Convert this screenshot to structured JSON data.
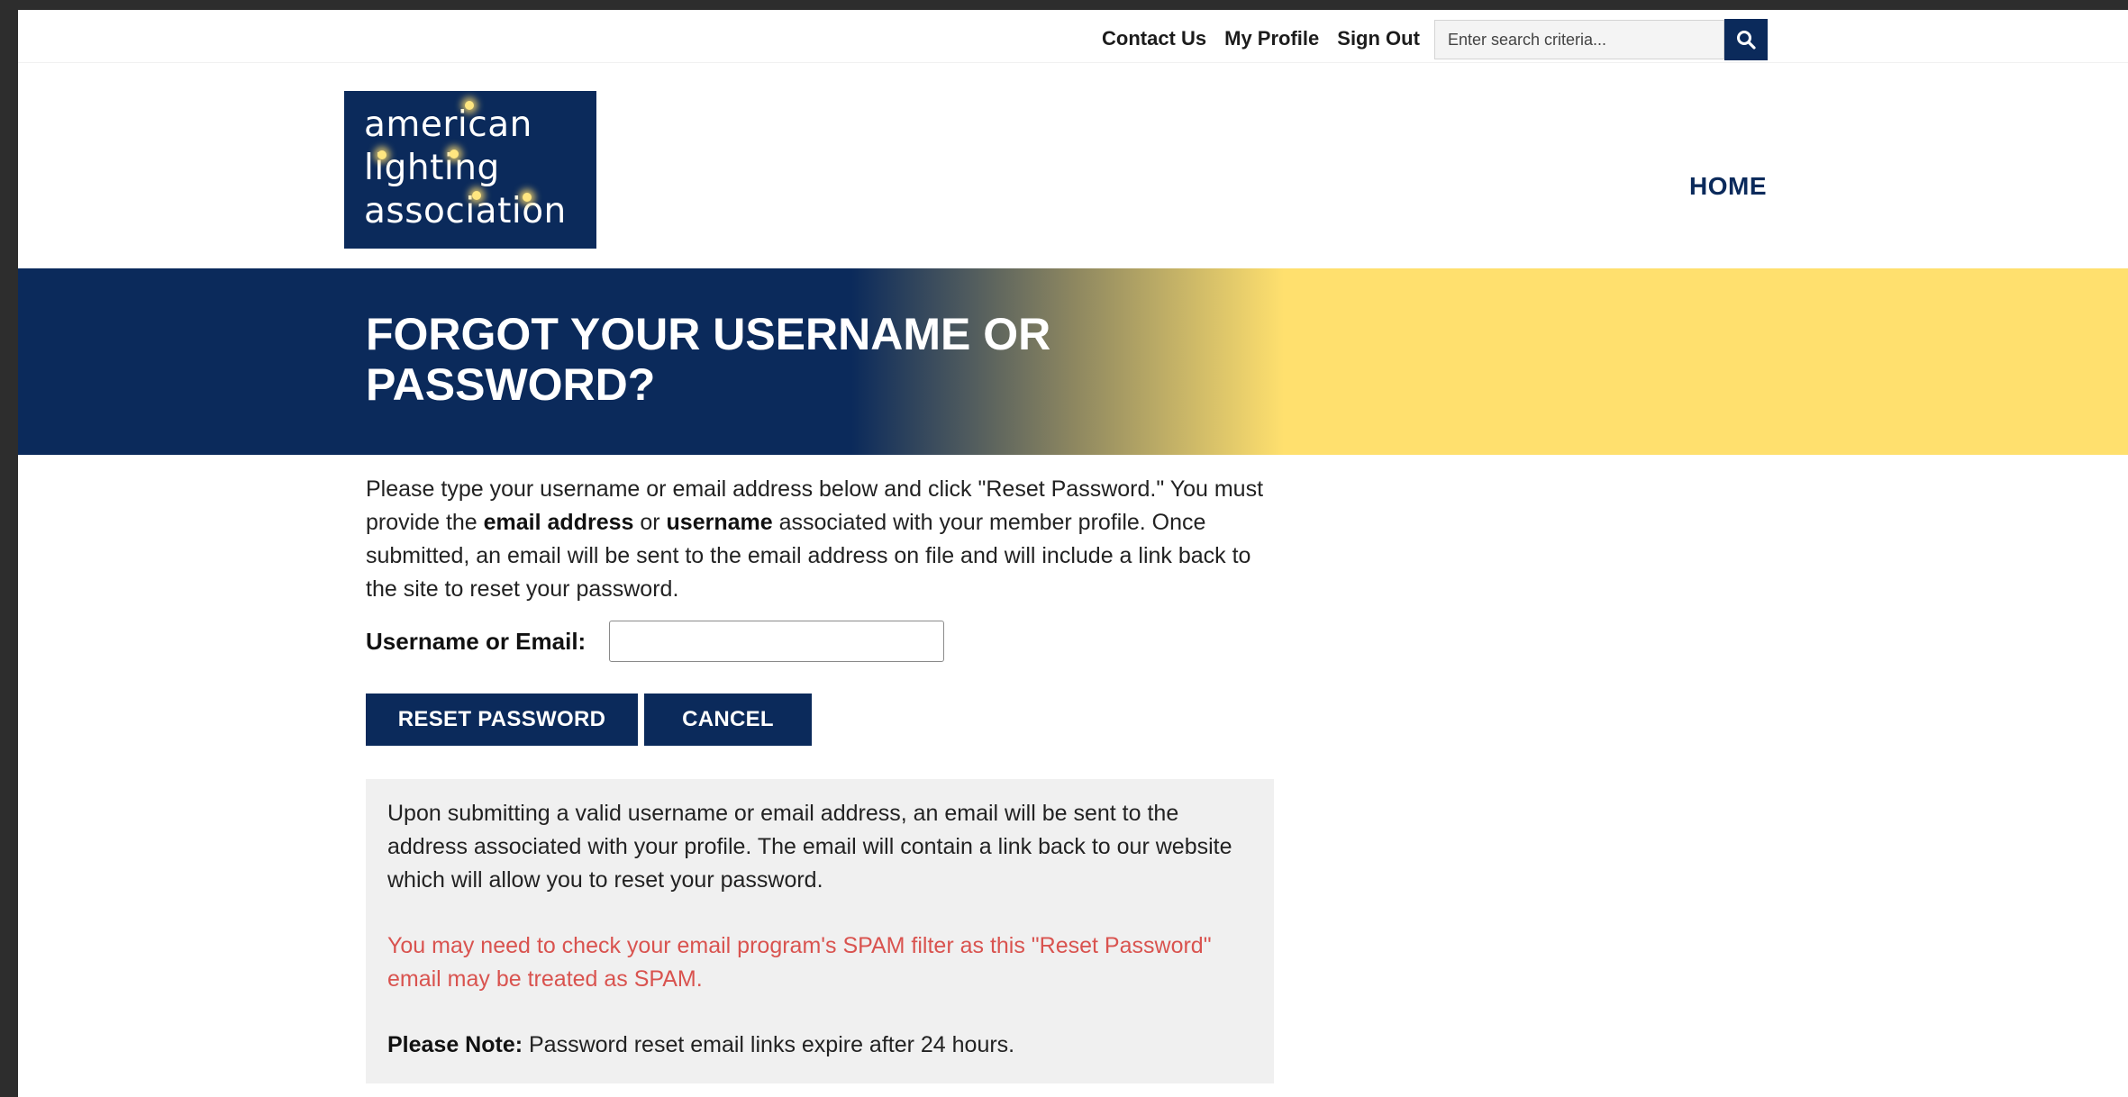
{
  "utility_nav": {
    "contact": "Contact Us",
    "profile": "My Profile",
    "sign_out": "Sign Out"
  },
  "search": {
    "placeholder": "Enter search criteria...",
    "icon": "search-icon"
  },
  "logo": {
    "line1": "american",
    "line2": "lighting",
    "line3": "association"
  },
  "main_nav": {
    "home": "HOME"
  },
  "banner": {
    "title": "FORGOT YOUR USERNAME OR PASSWORD?"
  },
  "intro": {
    "part1": "Please type your username or email address below and click \"Reset Password.\" You must provide the ",
    "bold1": "email address",
    "part2": " or ",
    "bold2": "username",
    "part3": " associated with your member profile. Once submitted, an email will be sent to the email address on file and will include a link back to the site to reset your password."
  },
  "form": {
    "label": "Username or Email:",
    "value": "",
    "reset_label": "RESET PASSWORD",
    "cancel_label": "CANCEL"
  },
  "notice": {
    "text1": "Upon submitting a valid username or email address, an email will be sent to the address associated with your profile. The email will contain a link back to our website which will allow you to reset your password.",
    "warning": "You may need to check your email program's SPAM filter as this \"Reset Password\" email may be treated as SPAM.",
    "note_label": "Please Note:",
    "note_text": " Password reset email links expire after 24 hours."
  },
  "colors": {
    "brand_navy": "#0b2a5b",
    "accent_yellow": "#ffe06e",
    "warning_red": "#d9534f",
    "notice_bg": "#f0f0f0"
  }
}
